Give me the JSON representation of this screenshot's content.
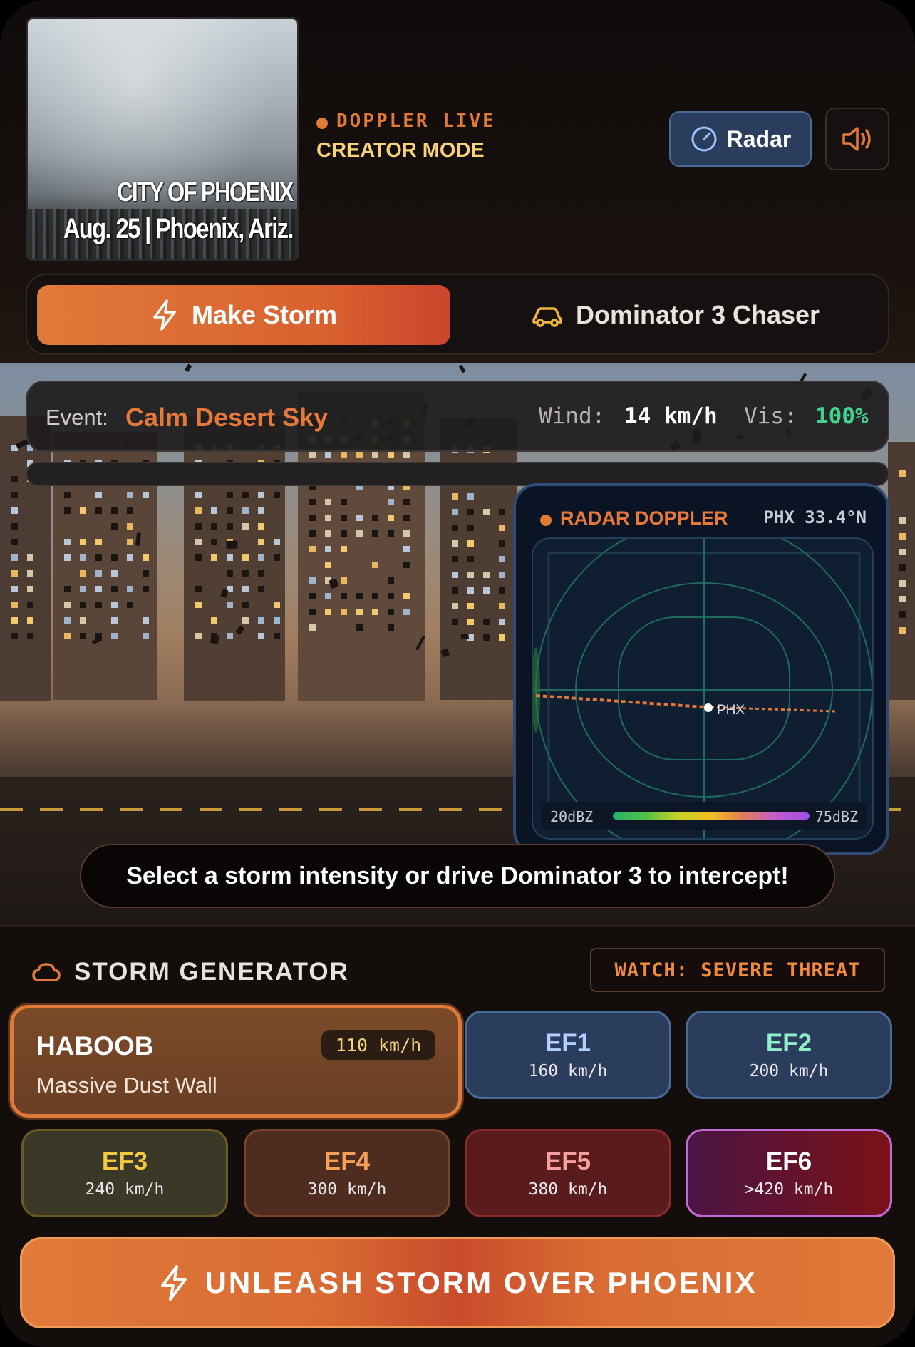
{
  "header": {
    "thumbnail": {
      "caption_line1": "CITY OF PHOENIX",
      "caption_line2": "Aug. 25 | Phoenix, Ariz."
    },
    "live_label": "DOPPLER LIVE",
    "mode_label": "CREATOR MODE",
    "radar_button": "Radar",
    "sound_icon": "speaker-icon"
  },
  "tabs": [
    {
      "label": "Make Storm",
      "icon": "lightning-icon",
      "active": true
    },
    {
      "label": "Dominator 3 Chaser",
      "icon": "car-icon",
      "active": false
    }
  ],
  "event": {
    "label": "Event:",
    "name": "Calm Desert Sky",
    "wind_label": "Wind:",
    "wind_value": "14 km/h",
    "vis_label": "Vis:",
    "vis_value": "100%"
  },
  "storm_progress": 0,
  "radar": {
    "title": "RADAR DOPPLER",
    "coord": "PHX 33.4°N",
    "city_label": "PHX",
    "scale_min": "20dBZ",
    "scale_max": "75dBZ"
  },
  "hint": "Select a storm intensity or drive Dominator 3 to intercept!",
  "generator": {
    "title": "STORM GENERATOR",
    "watch": "WATCH: SEVERE THREAT",
    "featured": {
      "name": "HABOOB",
      "subtitle": "Massive Dust Wall",
      "speed": "110 km/h"
    },
    "levels": [
      {
        "name": "EF1",
        "speed": "160 km/h"
      },
      {
        "name": "EF2",
        "speed": "200 km/h"
      },
      {
        "name": "EF3",
        "speed": "240 km/h"
      },
      {
        "name": "EF4",
        "speed": "300 km/h"
      },
      {
        "name": "EF5",
        "speed": "380 km/h"
      },
      {
        "name": "EF6",
        "speed": ">420 km/h"
      }
    ],
    "unleash_label": "UNLEASH STORM OVER PHOENIX"
  },
  "colors": {
    "accent": "#e07a3a",
    "live_green": "#42d28b",
    "radar_blue": "#2b3d5c"
  }
}
